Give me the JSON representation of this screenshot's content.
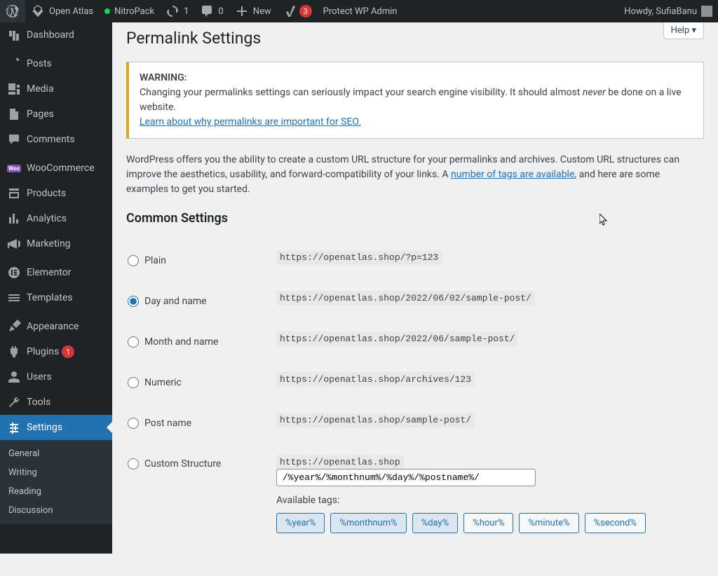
{
  "toolbar": {
    "site_name": "Open Atlas",
    "nitropack": "NitroPack",
    "updates": "1",
    "comments": "0",
    "new": "New",
    "yoast_count": "3",
    "protect": "Protect WP Admin",
    "howdy": "Howdy, SufiaBanu"
  },
  "menu": {
    "dashboard": "Dashboard",
    "posts": "Posts",
    "media": "Media",
    "pages": "Pages",
    "comments": "Comments",
    "woocommerce": "WooCommerce",
    "products": "Products",
    "analytics": "Analytics",
    "marketing": "Marketing",
    "elementor": "Elementor",
    "templates": "Templates",
    "appearance": "Appearance",
    "plugins": "Plugins",
    "plugins_count": "1",
    "users": "Users",
    "tools": "Tools",
    "settings": "Settings",
    "sub_general": "General",
    "sub_writing": "Writing",
    "sub_reading": "Reading",
    "sub_discussion": "Discussion"
  },
  "page": {
    "help": "Help ▾",
    "title": "Permalink Settings",
    "warning_label": "WARNING:",
    "warning_text_a": "Changing your permalinks settings can seriously impact your search engine visibility. It should almost ",
    "warning_text_em": "never",
    "warning_text_b": " be done on a live website.",
    "warning_link": "Learn about why permalinks are important for SEO.",
    "intro_a": "WordPress offers you the ability to create a custom URL structure for your permalinks and archives. Custom URL structures can improve the aesthetics, usability, and forward-compatibility of your links. A ",
    "intro_link": "number of tags are available",
    "intro_b": ", and here are some examples to get you started.",
    "common_heading": "Common Settings",
    "options": {
      "plain": {
        "label": "Plain",
        "example": "https://openatlas.shop/?p=123"
      },
      "day": {
        "label": "Day and name",
        "example": "https://openatlas.shop/2022/06/02/sample-post/"
      },
      "month": {
        "label": "Month and name",
        "example": "https://openatlas.shop/2022/06/sample-post/"
      },
      "numeric": {
        "label": "Numeric",
        "example": "https://openatlas.shop/archives/123"
      },
      "postname": {
        "label": "Post name",
        "example": "https://openatlas.shop/sample-post/"
      },
      "custom": {
        "label": "Custom Structure",
        "base": "https://openatlas.shop",
        "value": "/%year%/%monthnum%/%day%/%postname%/"
      }
    },
    "tags_label": "Available tags:",
    "tags": [
      "%year%",
      "%monthnum%",
      "%day%",
      "%hour%",
      "%minute%",
      "%second%"
    ]
  }
}
